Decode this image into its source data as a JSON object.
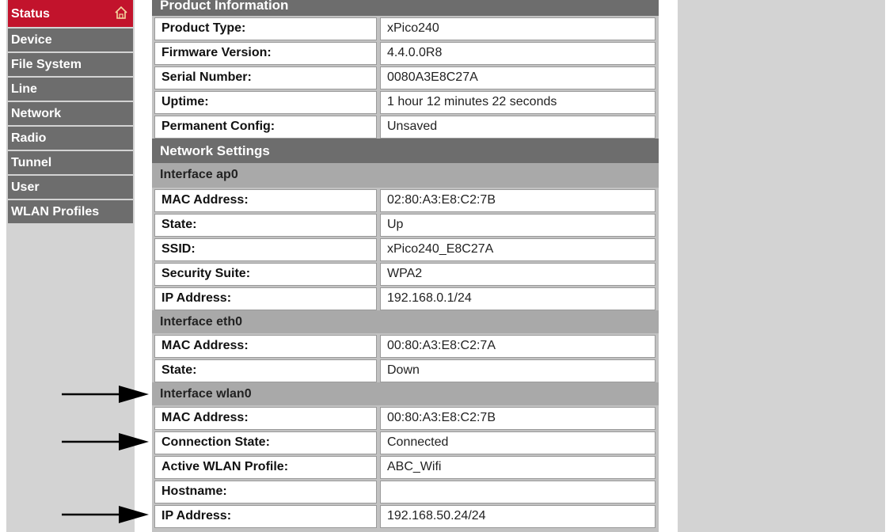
{
  "sidebar": {
    "items": [
      {
        "label": "Status",
        "active": true
      },
      {
        "label": "Device"
      },
      {
        "label": "File System"
      },
      {
        "label": "Line"
      },
      {
        "label": "Network"
      },
      {
        "label": "Radio"
      },
      {
        "label": "Tunnel"
      },
      {
        "label": "User"
      },
      {
        "label": "WLAN Profiles"
      }
    ],
    "status_icon": "home-icon"
  },
  "product": {
    "header": "Product Information",
    "rows": [
      {
        "label": "Product Type:",
        "value": "xPico240"
      },
      {
        "label": "Firmware Version:",
        "value": "4.4.0.0R8"
      },
      {
        "label": "Serial Number:",
        "value": "0080A3E8C27A"
      },
      {
        "label": "Uptime:",
        "value": "1 hour 12 minutes 22 seconds"
      },
      {
        "label": "Permanent Config:",
        "value": "Unsaved"
      }
    ]
  },
  "network": {
    "header": "Network Settings",
    "ap0": {
      "title": "Interface ap0",
      "rows": [
        {
          "label": "MAC Address:",
          "value": "02:80:A3:E8:C2:7B"
        },
        {
          "label": "State:",
          "value": "Up"
        },
        {
          "label": "SSID:",
          "value": "xPico240_E8C27A"
        },
        {
          "label": "Security Suite:",
          "value": "WPA2"
        },
        {
          "label": "IP Address:",
          "value": "192.168.0.1/24"
        }
      ]
    },
    "eth0": {
      "title": "Interface eth0",
      "rows": [
        {
          "label": "MAC Address:",
          "value": "00:80:A3:E8:C2:7A"
        },
        {
          "label": "State:",
          "value": "Down"
        }
      ]
    },
    "wlan0": {
      "title": "Interface wlan0",
      "rows": [
        {
          "label": "MAC Address:",
          "value": "00:80:A3:E8:C2:7B"
        },
        {
          "label": "Connection State:",
          "value": "Connected"
        },
        {
          "label": "Active WLAN Profile:",
          "value": "ABC_Wifi"
        },
        {
          "label": "Hostname:",
          "value": ""
        },
        {
          "label": "IP Address:",
          "value": "192.168.50.24/24"
        }
      ]
    }
  },
  "colors": {
    "accent_red": "#c2132c",
    "nav_gray": "#6d6d6d",
    "sub_header_gray": "#a9a9a9"
  }
}
